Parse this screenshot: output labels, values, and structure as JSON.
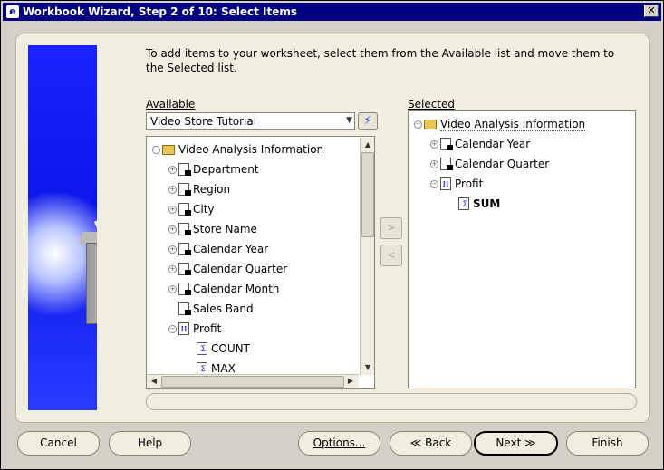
{
  "window": {
    "title": "Workbook Wizard, Step 2 of 10: Select Items",
    "close_glyph": "✕"
  },
  "intro": "To add items to your worksheet, select them from the Available list and move them to the Selected list.",
  "available": {
    "label": "Available",
    "business_area": "Video Store Tutorial",
    "items": [
      {
        "label": "Video Analysis Information",
        "type": "folder",
        "expander": "−"
      },
      {
        "label": "Department",
        "type": "item",
        "expander": "+"
      },
      {
        "label": "Region",
        "type": "item",
        "expander": "+"
      },
      {
        "label": "City",
        "type": "item",
        "expander": "+"
      },
      {
        "label": "Store Name",
        "type": "item",
        "expander": "+"
      },
      {
        "label": "Calendar Year",
        "type": "item",
        "expander": "+"
      },
      {
        "label": "Calendar Quarter",
        "type": "item",
        "expander": "+"
      },
      {
        "label": "Calendar Month",
        "type": "item",
        "expander": "+"
      },
      {
        "label": "Sales Band",
        "type": "item",
        "expander": ""
      },
      {
        "label": "Profit",
        "type": "measure",
        "expander": "−"
      },
      {
        "label": "COUNT",
        "type": "aggregate",
        "expander": ""
      },
      {
        "label": "MAX",
        "type": "aggregate",
        "expander": ""
      }
    ]
  },
  "selected": {
    "label": "Selected",
    "items": [
      {
        "label": "Video Analysis Information",
        "type": "folder",
        "expander": "−"
      },
      {
        "label": "Calendar Year",
        "type": "item",
        "expander": "+"
      },
      {
        "label": "Calendar Quarter",
        "type": "item",
        "expander": "+"
      },
      {
        "label": "Profit",
        "type": "measure",
        "expander": "−"
      },
      {
        "label": "SUM",
        "type": "aggregate",
        "expander": ""
      }
    ]
  },
  "move": {
    "add_glyph": ">",
    "remove_glyph": "<"
  },
  "buttons": {
    "cancel": "Cancel",
    "help": "Help",
    "options": "Options...",
    "back": "Back",
    "back_glyph": "≪",
    "next": "Next",
    "next_glyph": "≫",
    "finish": "Finish"
  },
  "scroll_glyphs": {
    "up": "▲",
    "down": "▼",
    "left": "◀",
    "right": "▶",
    "combo": "▼"
  },
  "colors": {
    "title_bar": "#000080",
    "panel": "#f1eddf",
    "banner": "#1a22ff"
  }
}
